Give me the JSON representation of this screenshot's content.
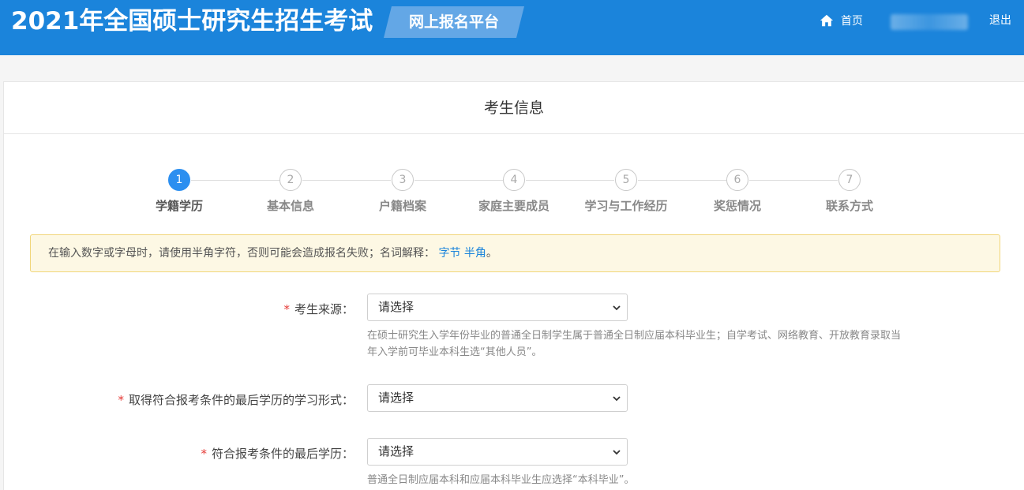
{
  "header": {
    "title": "2021年全国硕士研究生招生考试",
    "platform": "网上报名平台",
    "home_label": "首页",
    "logout_label": "退出",
    "bg_color": "#1b84db"
  },
  "panel": {
    "title": "考生信息"
  },
  "steps": [
    {
      "num": "1",
      "label": "学籍学历"
    },
    {
      "num": "2",
      "label": "基本信息"
    },
    {
      "num": "3",
      "label": "户籍档案"
    },
    {
      "num": "4",
      "label": "家庭主要成员"
    },
    {
      "num": "5",
      "label": "学习与工作经历"
    },
    {
      "num": "6",
      "label": "奖惩情况"
    },
    {
      "num": "7",
      "label": "联系方式"
    }
  ],
  "active_step": "1",
  "notice": {
    "text": "在输入数字或字母时，请使用半角字符，否则可能会造成报名失败；名词解释：",
    "link1": "字节",
    "link2": "半角",
    "end": "。"
  },
  "form": {
    "source": {
      "required_mark": "*",
      "label": "考生来源：",
      "value": "请选择",
      "help_line1": "在硕士研究生入学年份毕业的普通全日制学生属于普通全日制应届本科毕业生；自学考试、网络教育、开放教育录取当",
      "help_line2": "年入学前可毕业本科生选“其他人员”。"
    },
    "study_form": {
      "required_mark": "*",
      "label": "取得符合报考条件的最后学历的学习形式：",
      "value": "请选择"
    },
    "last_degree": {
      "required_mark": "*",
      "label": "符合报考条件的最后学历：",
      "value": "请选择",
      "help_line1": "普通全日制应届本科和应届本科毕业生应选择“本科毕业”。"
    }
  }
}
